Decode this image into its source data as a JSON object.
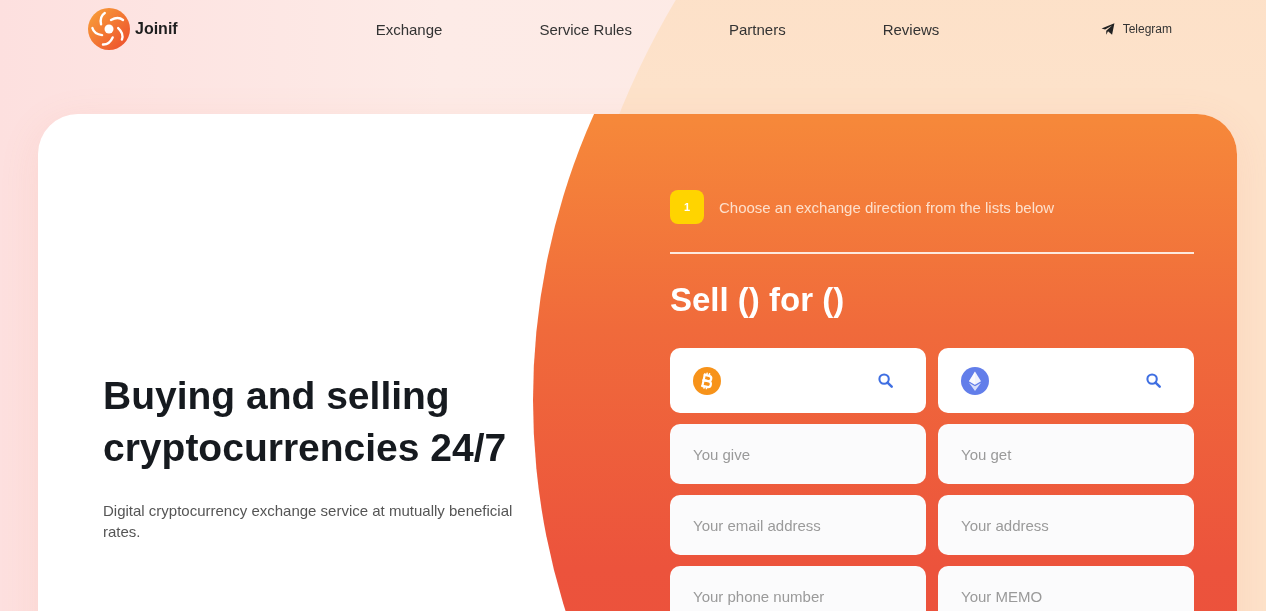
{
  "header": {
    "logo_text": "Joinif",
    "nav": [
      {
        "label": "Exchange"
      },
      {
        "label": "Service Rules"
      },
      {
        "label": "Partners"
      },
      {
        "label": "Reviews"
      }
    ],
    "telegram": "Telegram"
  },
  "hero": {
    "title": "Buying and selling cryptocurrencies 24/7",
    "subtitle": "Digital cryptocurrency exchange service at mutually beneficial rates."
  },
  "exchange": {
    "step": {
      "number": "1",
      "text": "Choose an exchange direction from the lists below"
    },
    "heading": "Sell () for ()",
    "selectors": [
      {
        "kind": "bitcoin"
      },
      {
        "kind": "ethereum"
      }
    ],
    "fields": [
      {
        "placeholder": "You give"
      },
      {
        "placeholder": "You get"
      },
      {
        "placeholder": "Your email address"
      },
      {
        "placeholder": "Your address"
      },
      {
        "placeholder": "Your phone number"
      },
      {
        "placeholder": "Your MEMO"
      }
    ]
  }
}
